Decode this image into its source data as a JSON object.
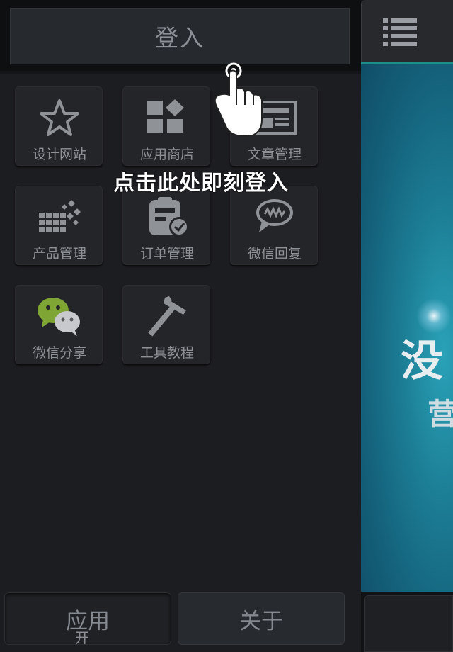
{
  "login": {
    "label": "登入"
  },
  "hint": {
    "text": "点击此处即刻登入"
  },
  "apps": [
    {
      "label": "设计网站",
      "icon": "star-icon"
    },
    {
      "label": "应用商店",
      "icon": "app-store-icon"
    },
    {
      "label": "文章管理",
      "icon": "article-icon"
    },
    {
      "label": "产品管理",
      "icon": "product-grid-icon"
    },
    {
      "label": "订单管理",
      "icon": "order-clipboard-icon"
    },
    {
      "label": "微信回复",
      "icon": "chat-bubble-icon"
    },
    {
      "label": "微信分享",
      "icon": "wechat-icon"
    },
    {
      "label": "工具教程",
      "icon": "hammer-icon"
    }
  ],
  "bottom_nav": {
    "apps_label": "应用",
    "about_label": "关于"
  },
  "main": {
    "banner_line1": "没",
    "banner_line2": "营",
    "footer_partial": "开"
  },
  "colors": {
    "panel": "#1c1d20",
    "accent_teal": "#1b8f8a",
    "banner": "#1c7e95"
  }
}
